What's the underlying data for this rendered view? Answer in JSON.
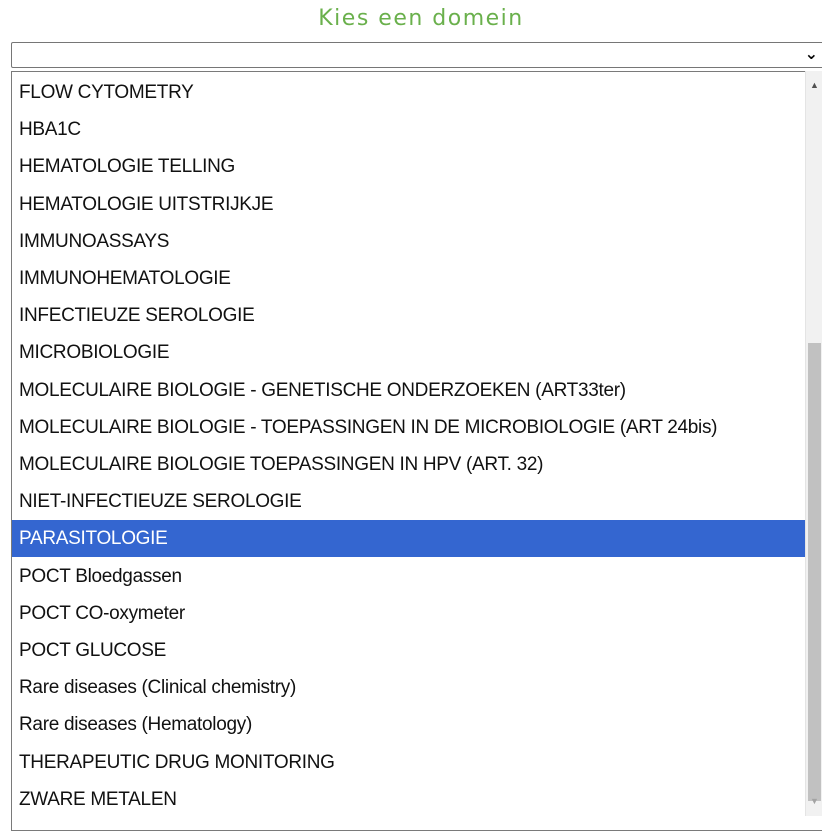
{
  "title": "Kies een domein",
  "select": {
    "value": "",
    "arrow_icon": "chevron-down-icon"
  },
  "options": [
    "FLOW CYTOMETRY",
    "HBA1C",
    "HEMATOLOGIE TELLING",
    "HEMATOLOGIE UITSTRIJKJE",
    "IMMUNOASSAYS",
    "IMMUNOHEMATOLOGIE",
    "INFECTIEUZE SEROLOGIE",
    "MICROBIOLOGIE",
    "MOLECULAIRE BIOLOGIE - GENETISCHE ONDERZOEKEN (ART33ter)",
    "MOLECULAIRE BIOLOGIE - TOEPASSINGEN IN DE MICROBIOLOGIE (ART 24bis)",
    "MOLECULAIRE BIOLOGIE TOEPASSINGEN IN HPV (ART. 32)",
    "NIET-INFECTIEUZE SEROLOGIE",
    "PARASITOLOGIE",
    "POCT Bloedgassen",
    "POCT CO-oxymeter",
    "POCT GLUCOSE",
    "Rare diseases (Clinical chemistry)",
    "Rare diseases (Hematology)",
    "THERAPEUTIC DRUG MONITORING",
    "ZWARE METALEN"
  ],
  "selected_option": "PARASITOLOGIE",
  "colors": {
    "title": "#6ab04c",
    "selected_bg": "#3466d0",
    "selected_text": "#ffffff"
  }
}
